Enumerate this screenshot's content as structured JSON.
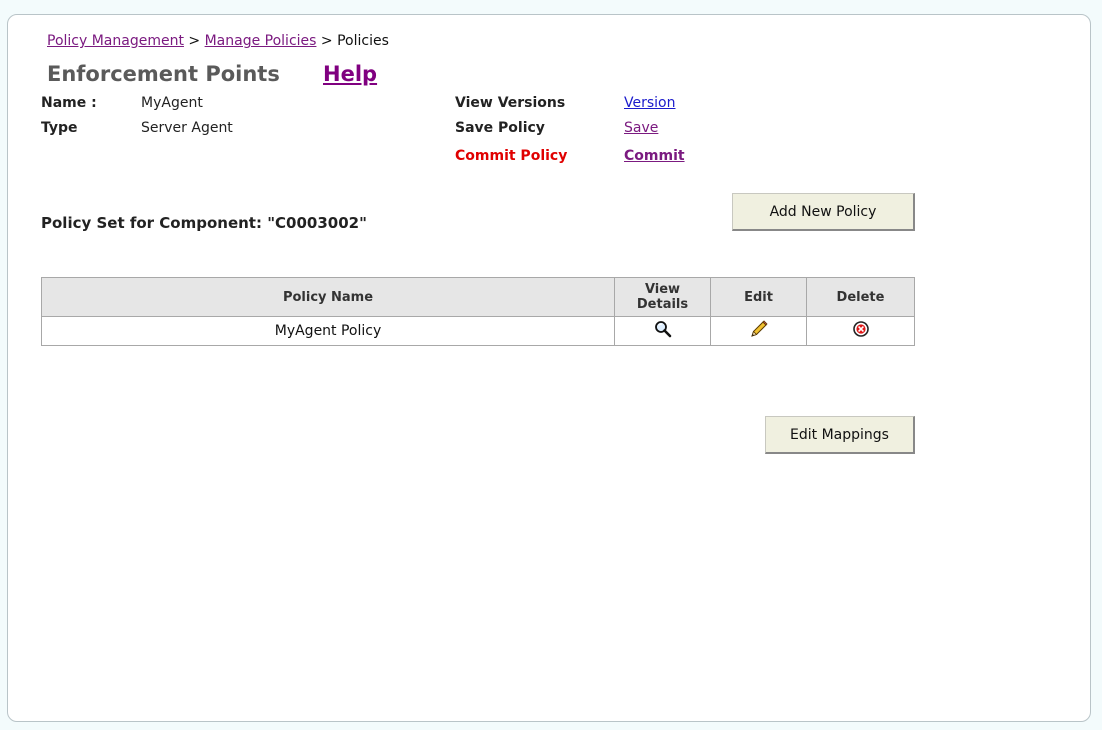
{
  "breadcrumb": {
    "policy_management": "Policy Management",
    "sep1": ">",
    "manage_policies": "Manage Policies",
    "sep2": ">",
    "current": "Policies"
  },
  "header": {
    "title": "Enforcement Points",
    "help": "Help"
  },
  "info": {
    "name_label": "Name :",
    "name_value": "MyAgent",
    "type_label": "Type",
    "type_value": "Server Agent"
  },
  "actions": {
    "view_versions_label": "View Versions",
    "view_versions_link": "Version",
    "save_policy_label": "Save Policy",
    "save_policy_link": "Save",
    "commit_policy_label": "Commit Policy",
    "commit_policy_link": "Commit"
  },
  "buttons": {
    "add_new_policy": "Add New Policy",
    "edit_mappings": "Edit Mappings"
  },
  "policy_set": {
    "label": "Policy Set for Component: \"C0003002\""
  },
  "table": {
    "headers": {
      "policy_name": "Policy Name",
      "view_details_1": "View",
      "view_details_2": "Details",
      "edit": "Edit",
      "delete": "Delete"
    },
    "rows": [
      {
        "policy_name": "MyAgent Policy"
      }
    ]
  },
  "icons": {
    "view": "magnifier-icon",
    "edit": "pencil-icon",
    "delete": "delete-circle-icon"
  },
  "colors": {
    "link": "#7b1a80",
    "commit_label": "#e00000",
    "header_bg": "#e6e6e6",
    "button_bg": "#f0f0e0"
  }
}
